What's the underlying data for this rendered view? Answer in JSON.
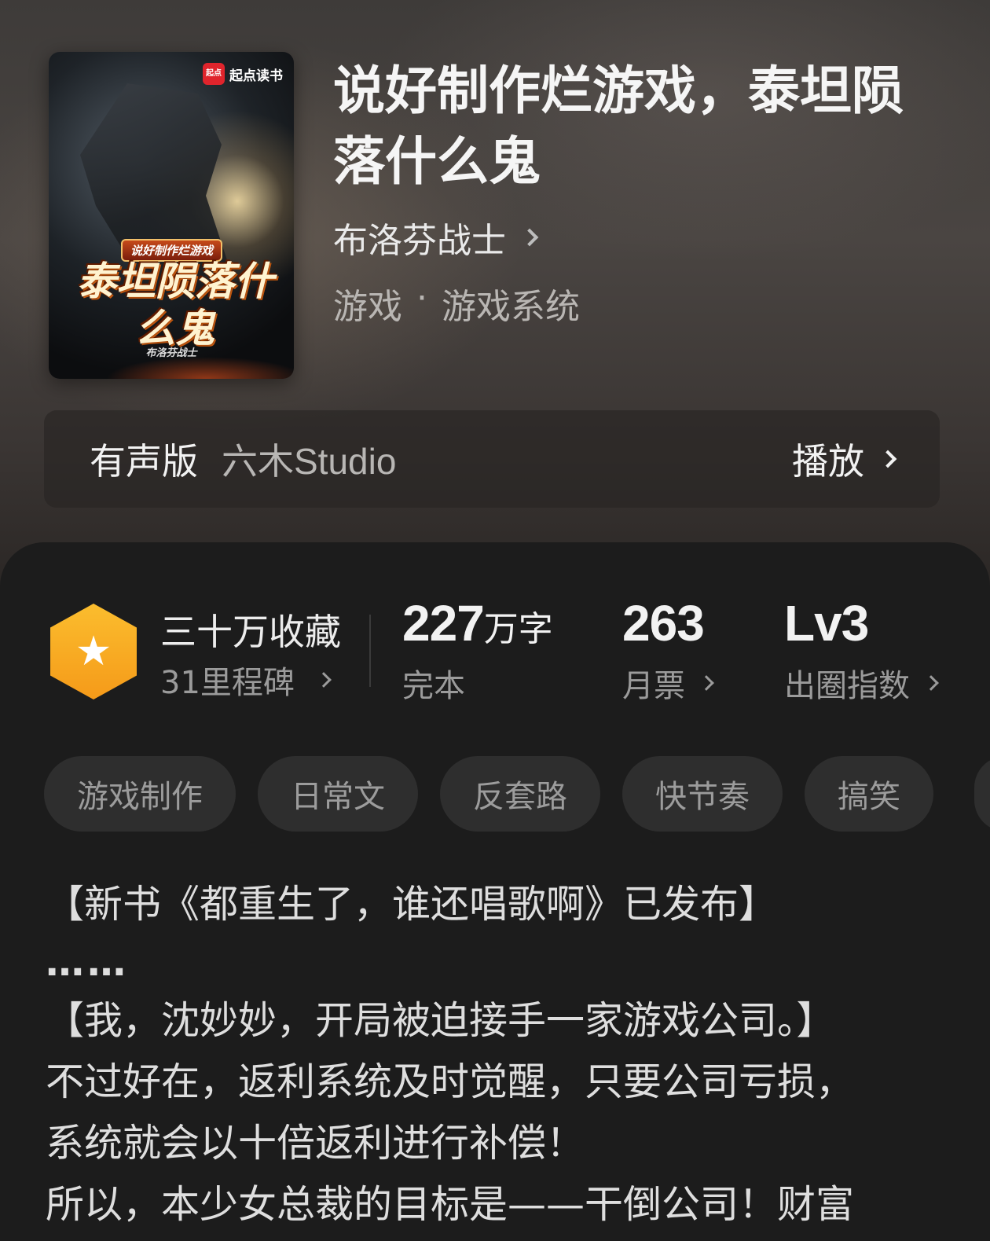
{
  "book": {
    "title": "说好制作烂游戏，泰坦陨落什么鬼",
    "author": "布洛芬战士",
    "genre_main": "游戏",
    "genre_separator": "·",
    "genre_sub": "游戏系统"
  },
  "cover": {
    "brand_logo": "起点",
    "brand_text": "起点读书",
    "subtitle": "说好制作烂游戏",
    "title": "泰坦陨落什么鬼",
    "author": "布洛芬战士"
  },
  "audio": {
    "label": "有声版",
    "studio": "六木Studio",
    "play_label": "播放"
  },
  "stats": {
    "favorites_title": "三十万收藏",
    "milestone": "31里程碑",
    "words_num": "227",
    "words_unit": "万字",
    "words_caption": "完本",
    "monthly_tickets": "263",
    "monthly_caption": "月票",
    "level": "Lv3",
    "level_caption": "出圈指数"
  },
  "tags": [
    "游戏制作",
    "日常文",
    "反套路",
    "快节奏",
    "搞笑"
  ],
  "description": {
    "line1": "【新书《都重生了，谁还唱歌啊》已发布】",
    "line2": "……",
    "line3": "【我，沈妙妙，开局被迫接手一家游戏公司。】",
    "line4": "不过好在，返利系统及时觉醒，只要公司亏损，",
    "line5": "系统就会以十倍返利进行补偿！",
    "line6": "所以，本少女总裁的目标是——干倒公司！财富"
  },
  "colors": {
    "accent_orange": "#f5a623",
    "panel_bg": "#1c1c1c",
    "tag_bg": "#2e2e2e"
  }
}
